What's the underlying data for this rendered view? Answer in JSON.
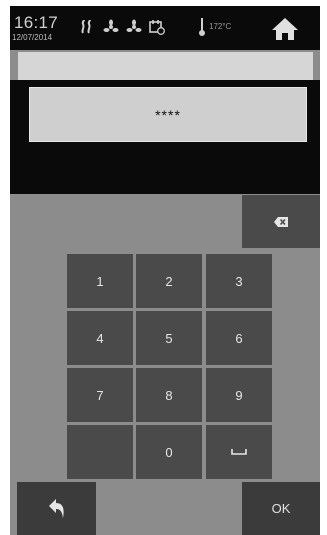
{
  "status": {
    "time": "16:17",
    "date": "12/07/2014",
    "temperature": "172°C",
    "icons": [
      "steam-icon",
      "fan-icon",
      "fan-icon",
      "timer-calendar-icon"
    ],
    "home_icon": "home-icon"
  },
  "pin": {
    "masked_value": "****"
  },
  "keypad": {
    "keys": [
      "1",
      "2",
      "3",
      "4",
      "5",
      "6",
      "7",
      "8",
      "9",
      "",
      "0",
      "␣"
    ],
    "backspace_icon": "backspace-icon",
    "space_icon": "space-icon"
  },
  "footer": {
    "back_icon": "back-arrow-icon",
    "ok_label": "OK"
  },
  "colors": {
    "status_bar": "#0a0a0a",
    "background": "#8c8c8c",
    "key": "#4a4a4a",
    "pin_box": "#cfcfcf"
  }
}
